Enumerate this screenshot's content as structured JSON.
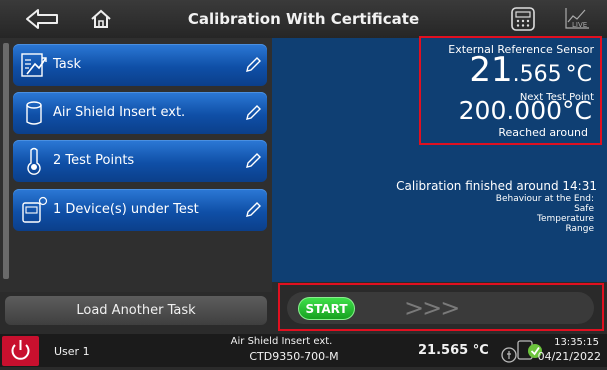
{
  "header": {
    "title": "Calibration With Certificate",
    "back_icon": "back-arrow-icon",
    "home_icon": "home-icon",
    "calculator_icon": "calculator-icon",
    "live_icon_label": "LIVE"
  },
  "tasks": [
    {
      "label": "Task",
      "icon": "task-icon"
    },
    {
      "label": "Air Shield Insert ext.",
      "icon": "insert-icon"
    },
    {
      "label": "2 Test Points",
      "icon": "thermometer-icon"
    },
    {
      "label": "1 Device(s) under Test",
      "icon": "device-icon"
    }
  ],
  "load_button": "Load Another Task",
  "sensor": {
    "label": "External Reference Sensor",
    "value_int": "21",
    "value_dec": ".565",
    "unit": "°C",
    "next_label": "Next Test Point",
    "next_int": "200",
    "next_dec": ".000",
    "next_unit": "°C",
    "reached": "Reached around"
  },
  "status": {
    "finished": "Calibration finished around 14:31",
    "behaviour_label": "Behaviour at the End:",
    "behaviour_line1": "Safe",
    "behaviour_line2": "Temperature",
    "behaviour_line3": "Range"
  },
  "start": {
    "label": "START",
    "arrows": ">>>"
  },
  "footer": {
    "user": "User 1",
    "insert_line1": "Air Shield Insert ext.",
    "insert_line2": "CTD9350-700-M",
    "temperature": "21.565 °C",
    "time": "13:35:15",
    "date": "04/21/2022"
  },
  "colors": {
    "accent_blue": "#0f4fa7",
    "panel_blue": "#0f3f73",
    "highlight_red": "#e01020",
    "start_green": "#16a020",
    "power_red": "#c8102e"
  }
}
